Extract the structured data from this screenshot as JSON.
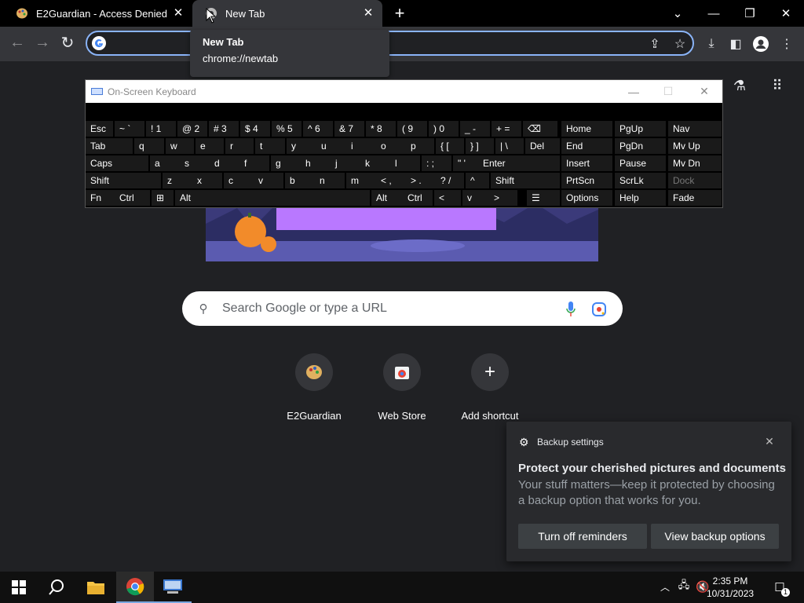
{
  "browser": {
    "tabs": [
      {
        "title": "E2Guardian - Access Denied",
        "active": false
      },
      {
        "title": "New Tab",
        "active": true
      }
    ],
    "tooltip": {
      "title": "New Tab",
      "url": "chrome://newtab"
    },
    "omnibox": {
      "value": ""
    }
  },
  "newtab": {
    "search_placeholder": "Search Google or type a URL",
    "shortcuts": [
      {
        "label": "E2Guardian",
        "icon": "palette-icon"
      },
      {
        "label": "Web Store",
        "icon": "web-store-icon"
      },
      {
        "label": "Add shortcut",
        "icon": "plus-icon"
      }
    ]
  },
  "osk": {
    "title": "On-Screen Keyboard",
    "rows": [
      [
        "Esc",
        "~ `",
        "! 1",
        "@ 2",
        "# 3",
        "$ 4",
        "% 5",
        "^ 6",
        "& 7",
        "* 8",
        "( 9",
        ") 0",
        "_ -",
        "+ =",
        "⌫"
      ],
      [
        "Tab",
        "q",
        "w",
        "e",
        "r",
        "t",
        "y",
        "u",
        "i",
        "o",
        "p",
        "{ [",
        "} ]",
        "| \\",
        "Del"
      ],
      [
        "Caps",
        "a",
        "s",
        "d",
        "f",
        "g",
        "h",
        "j",
        "k",
        "l",
        ": ;",
        "\" '",
        "Enter"
      ],
      [
        "Shift",
        "z",
        "x",
        "c",
        "v",
        "b",
        "n",
        "m",
        "< ,",
        "> .",
        "? /",
        "^",
        "Shift"
      ],
      [
        "Fn",
        "Ctrl",
        "⊞",
        "Alt",
        "",
        "Alt",
        "Ctrl",
        "<",
        "v",
        ">",
        "☰"
      ]
    ],
    "nav_keys": [
      [
        "Home",
        "PgUp",
        "Nav"
      ],
      [
        "End",
        "PgDn",
        "Mv Up"
      ],
      [
        "Insert",
        "Pause",
        "Mv Dn"
      ],
      [
        "PrtScn",
        "ScrLk",
        "Dock"
      ],
      [
        "Options",
        "Help",
        "Fade"
      ]
    ]
  },
  "backup_popup": {
    "title": "Backup settings",
    "heading": "Protect your cherished pictures and documents",
    "body": "Your stuff matters—keep it protected by choosing a backup option that works for you.",
    "buttons": {
      "turn_off": "Turn off reminders",
      "view": "View backup options"
    }
  },
  "taskbar": {
    "time": "2:35 PM",
    "date": "10/31/2023",
    "notification_count": "1"
  }
}
